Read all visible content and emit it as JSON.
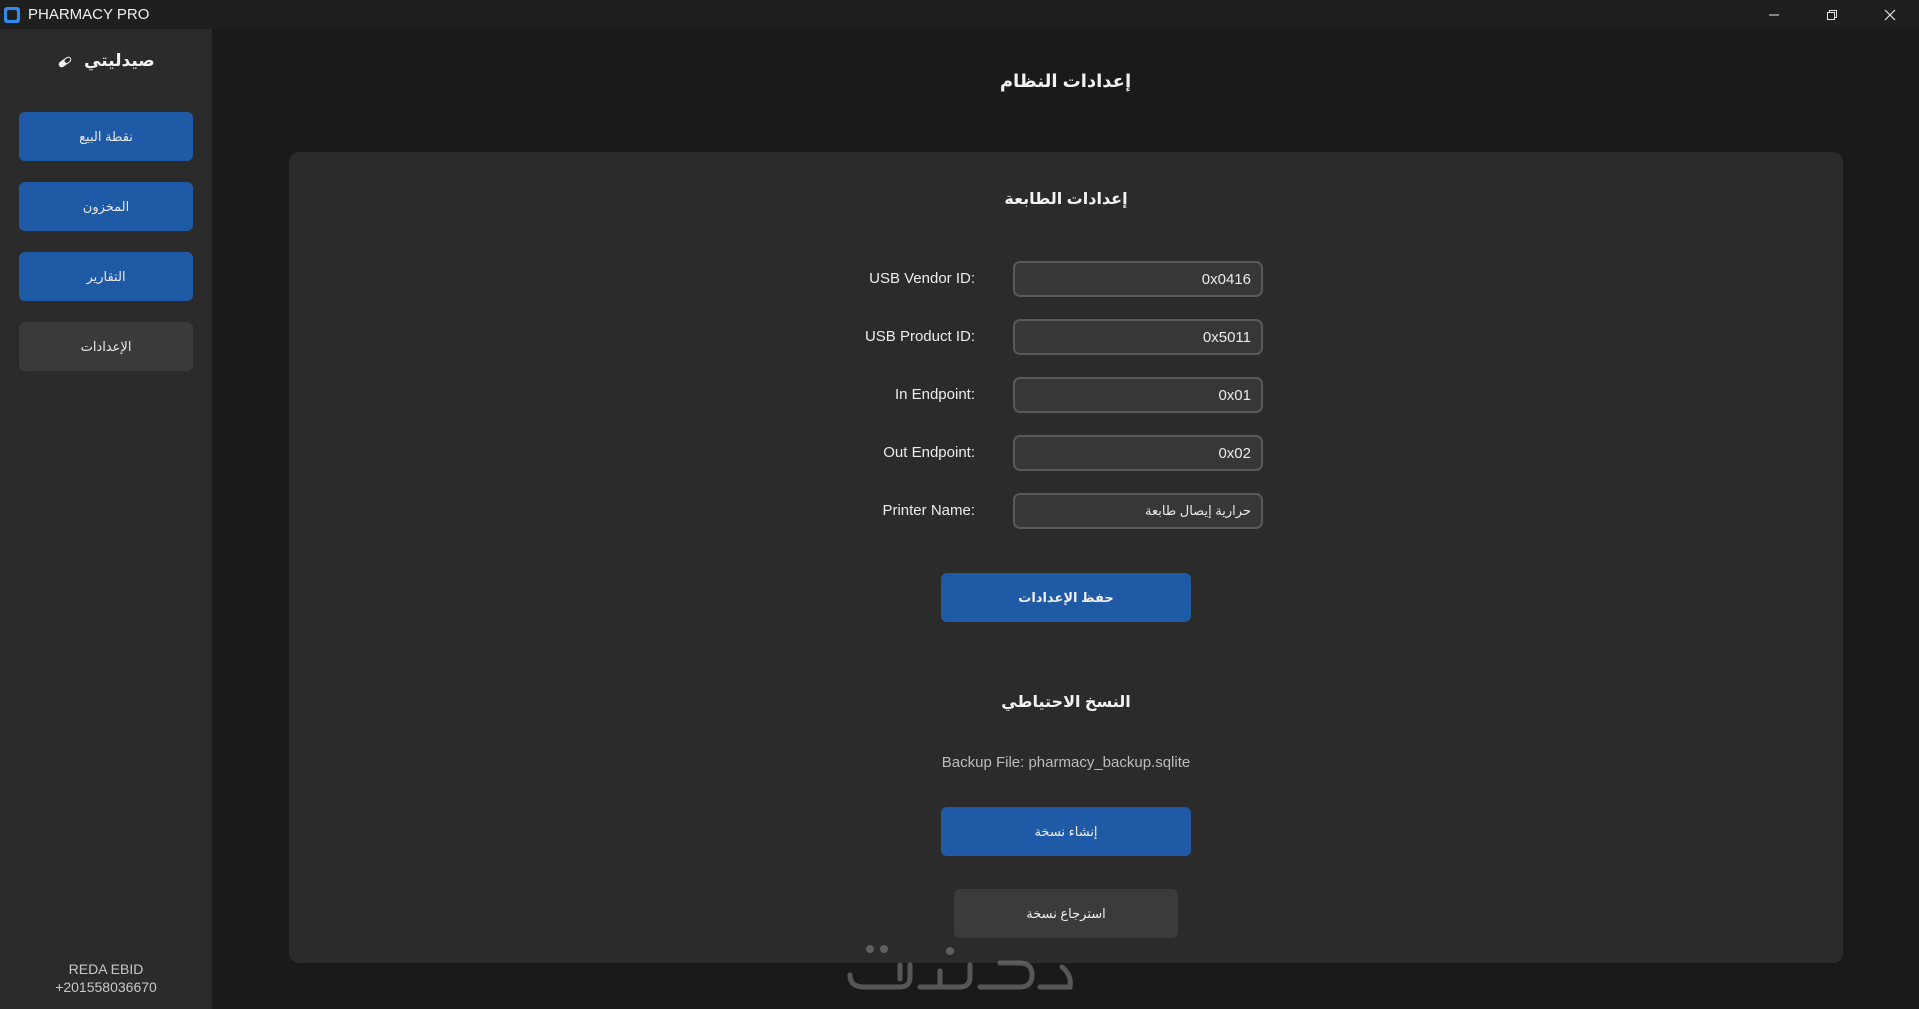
{
  "window": {
    "title": "PHARMACY PRO",
    "controls": {
      "minimize": "minimize-icon",
      "restore": "restore-icon",
      "close": "close-icon"
    }
  },
  "sidebar": {
    "brand": "صيدليتي",
    "brand_icon": "pill-icon",
    "items": [
      {
        "label": "نقطة البيع",
        "style": "blue"
      },
      {
        "label": "المخزون",
        "style": "blue"
      },
      {
        "label": "التقارير",
        "style": "blue"
      },
      {
        "label": "الإعدادات",
        "style": "gray"
      }
    ],
    "footer": {
      "name": "REDA EBID",
      "phone": "+201558036670"
    }
  },
  "main": {
    "title": "إعدادات النظام",
    "printer": {
      "title": "إعدادات الطابعة",
      "fields": [
        {
          "label": "USB Vendor ID:",
          "value": "0x0416"
        },
        {
          "label": "USB Product ID:",
          "value": "0x5011"
        },
        {
          "label": "In Endpoint:",
          "value": "0x01"
        },
        {
          "label": "Out Endpoint:",
          "value": "0x02"
        },
        {
          "label": "Printer Name:",
          "value": "حرارية إيصال طابعة"
        }
      ],
      "save_label": "حفظ الإعدادات"
    },
    "backup": {
      "title": "النسخ الاحتياطي",
      "file_text": "Backup File: pharmacy_backup.sqlite",
      "create_label": "إنشاء نسخة",
      "restore_label": "استرجاع نسخة"
    }
  },
  "colors": {
    "background": "#1a1a1a",
    "sidebar": "#2b2b2b",
    "panel": "#2b2b2b",
    "accent_blue": "#1f5aa6",
    "button_gray": "#3a3a3a",
    "input_bg": "#373737",
    "input_border": "#5a5a5a"
  }
}
